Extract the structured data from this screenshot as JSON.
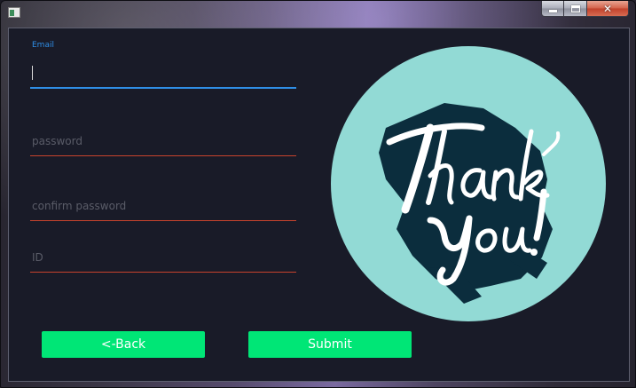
{
  "window": {
    "icon": "app-window-icon",
    "controls": {
      "minimize_icon": "minimize-icon",
      "maximize_icon": "maximize-icon",
      "close_label": "✕"
    }
  },
  "form": {
    "email": {
      "label": "Email",
      "value": "",
      "placeholder": "",
      "underline_color": "#2f8ee6"
    },
    "password": {
      "value": "",
      "placeholder": "password",
      "underline_color": "#c8432d"
    },
    "confirm_password": {
      "value": "",
      "placeholder": "confirm password",
      "underline_color": "#c8432d"
    },
    "id": {
      "value": "",
      "placeholder": "ID",
      "underline_color": "#c8432d"
    }
  },
  "buttons": {
    "back_label": "<-Back",
    "submit_label": "Submit",
    "color": "#00e676"
  },
  "artwork": {
    "text": "Thank You!",
    "circle_color": "#92dad5",
    "shadow_color": "#0b2d3d",
    "text_color": "#ffffff"
  },
  "colors": {
    "background": "#191b28",
    "accent": "#2f8ee6",
    "error": "#c8432d"
  }
}
